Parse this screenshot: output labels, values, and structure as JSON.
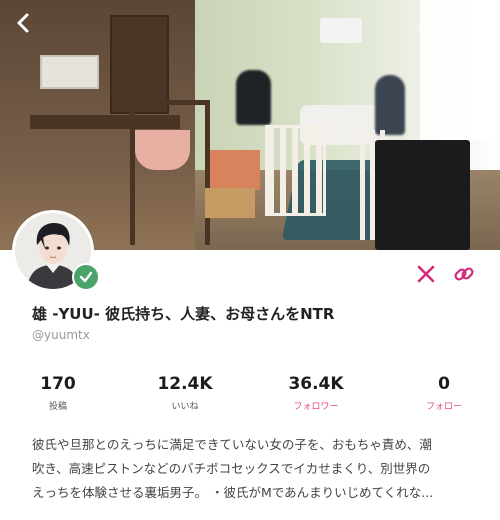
{
  "profile": {
    "display_name": "雄 -YUU- 彼氏持ち、人妻、お母さんをNTR",
    "handle": "@yuumtx",
    "verified": true
  },
  "stats": [
    {
      "value": "170",
      "label": "投稿",
      "color": "#555555"
    },
    {
      "value": "12.4K",
      "label": "いいね",
      "color": "#555555"
    },
    {
      "value": "36.4K",
      "label": "フォロワー",
      "color": "#e24a86"
    },
    {
      "value": "0",
      "label": "フォロー",
      "color": "#e24a86"
    }
  ],
  "bio": {
    "line1": "彼氏や旦那とのえっちに満足できていない女の子を、おもちゃ責め、潮",
    "line2": "吹き、高速ピストンなどのバチボコセックスでイカせまくり、別世界の",
    "line3": "えっちを体験させる裏垢男子。 ・彼氏がMであんまりいじめてくれな..."
  },
  "icons": {
    "back": "chevron-left-icon",
    "share": "share-icon",
    "more": "more-dots-icon",
    "x": "x-logo-icon",
    "link": "link-icon",
    "verified": "verified-check-icon"
  },
  "colors": {
    "accent": "#d4297a",
    "verified": "#4aa36a"
  }
}
